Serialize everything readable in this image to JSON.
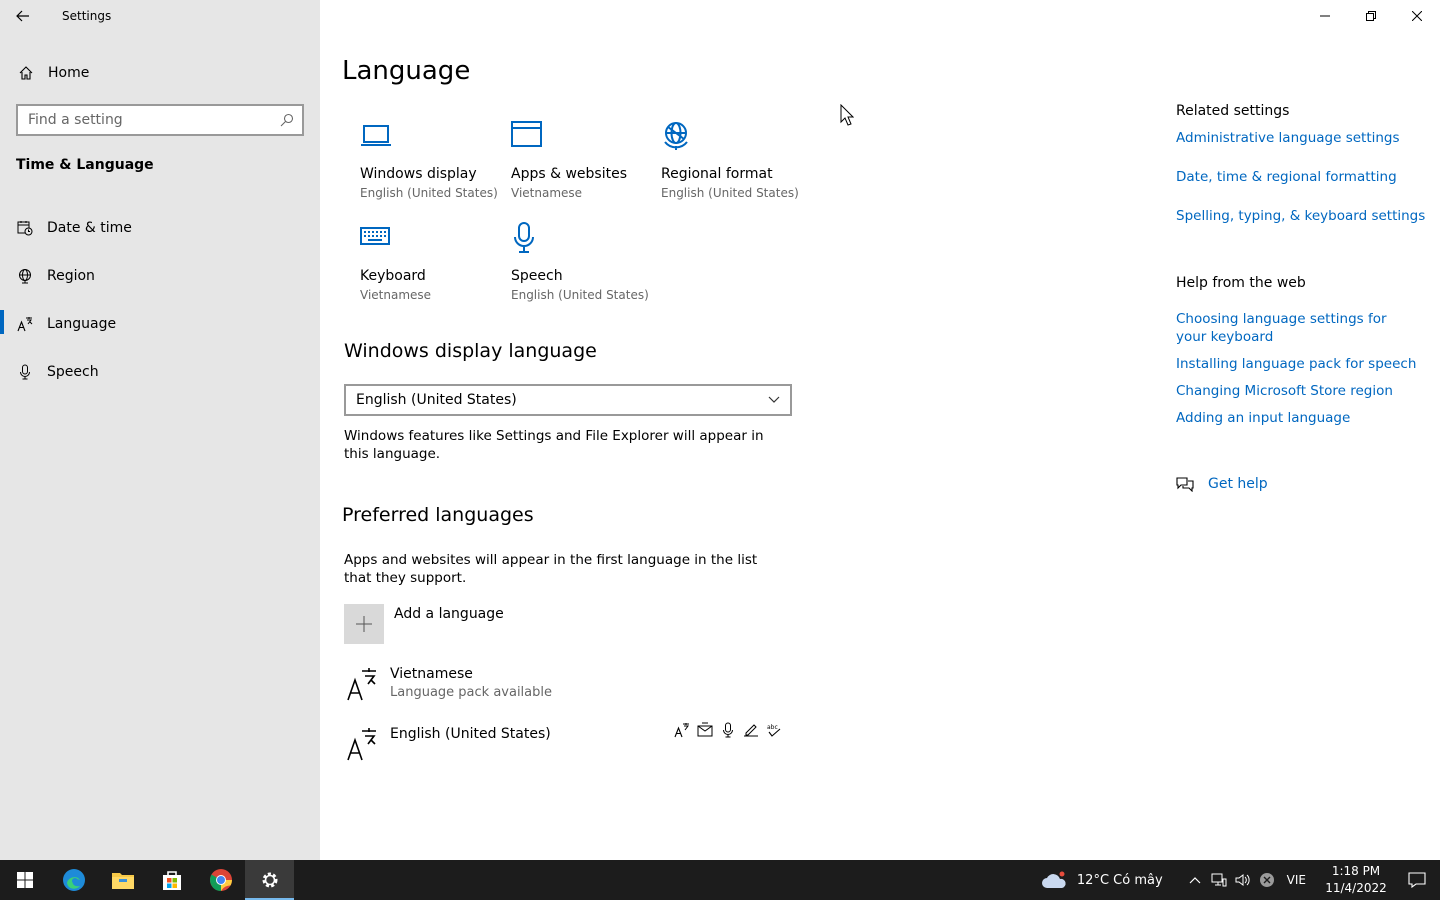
{
  "window": {
    "title": "Settings"
  },
  "sidebar": {
    "home_label": "Home",
    "search_placeholder": "Find a setting",
    "section_title": "Time & Language",
    "items": [
      {
        "label": "Date & time",
        "icon": "calendar-clock-icon"
      },
      {
        "label": "Region",
        "icon": "globe-icon"
      },
      {
        "label": "Language",
        "icon": "language-icon",
        "active": true
      },
      {
        "label": "Speech",
        "icon": "microphone-icon"
      }
    ]
  },
  "main": {
    "title": "Language",
    "tiles": [
      {
        "label": "Windows display",
        "sub": "English (United States)",
        "icon": "laptop-icon"
      },
      {
        "label": "Apps & websites",
        "sub": "Vietnamese",
        "icon": "window-icon"
      },
      {
        "label": "Regional format",
        "sub": "English (United States)",
        "icon": "regional-globe-icon"
      },
      {
        "label": "Keyboard",
        "sub": "Vietnamese",
        "icon": "keyboard-icon"
      },
      {
        "label": "Speech",
        "sub": "English (United States)",
        "icon": "microphone-icon"
      }
    ],
    "display_language": {
      "heading": "Windows display language",
      "selected": "English (United States)",
      "description": "Windows features like Settings and File Explorer will appear in this language."
    },
    "preferred": {
      "heading": "Preferred languages",
      "description": "Apps and websites will appear in the first language in the list that they support.",
      "add_label": "Add a language",
      "languages": [
        {
          "name": "Vietnamese",
          "sub": "Language pack available"
        },
        {
          "name": "English (United States)",
          "sub": ""
        }
      ]
    }
  },
  "related": {
    "heading": "Related settings",
    "links": [
      "Administrative language settings",
      "Date, time & regional formatting",
      "Spelling, typing, & keyboard settings"
    ],
    "help_heading": "Help from the web",
    "help_links": [
      "Choosing language settings for your keyboard",
      "Installing language pack for speech",
      "Changing Microsoft Store region",
      "Adding an input language"
    ],
    "get_help": "Get help"
  },
  "taskbar": {
    "weather": "12°C  Có mây",
    "input_lang": "VIE",
    "time": "1:18 PM",
    "date": "11/4/2022"
  },
  "colors": {
    "accent": "#0067c0",
    "sidebar_bg": "#e6e6e6",
    "taskbar_bg": "#1c1c1c"
  }
}
